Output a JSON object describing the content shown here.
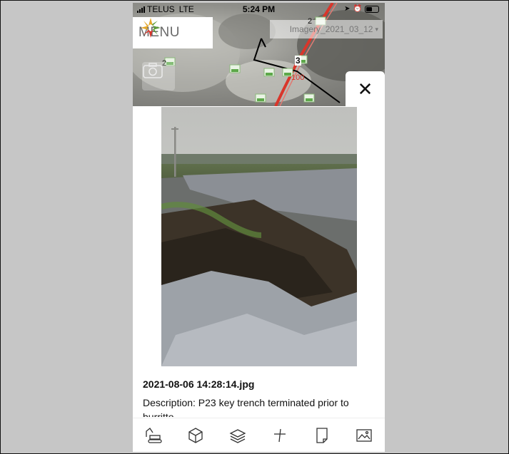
{
  "status_bar": {
    "carrier": "TELUS",
    "network": "LTE",
    "time": "5:24 PM"
  },
  "menu": {
    "label": "MENU"
  },
  "imagery": {
    "selected": "Imagery_2021_03_12"
  },
  "map": {
    "cluster_counts": [
      "2",
      "2",
      "3"
    ],
    "distance_label": "100"
  },
  "photo": {
    "filename": "2021-08-06 14:28:14.jpg",
    "description": "Description: P23 key trench terminated prior to",
    "description_cut": "burritto"
  },
  "toolbar": {
    "icons": [
      "excavator-icon",
      "cube-icon",
      "layers-icon",
      "measure-icon",
      "page-icon",
      "image-icon"
    ]
  },
  "colors": {
    "accent_red": "#d9362b",
    "close": "#111111",
    "menu_text": "#6a6a6a"
  }
}
